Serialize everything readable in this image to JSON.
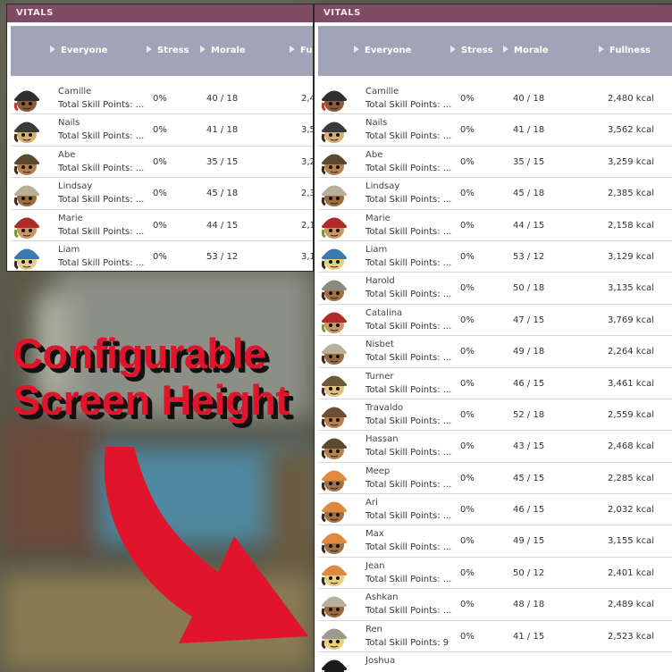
{
  "window_title": "VITALS",
  "headers": {
    "everyone": "Everyone",
    "stress": "Stress",
    "morale": "Morale",
    "fullness": "Fullness",
    "fullness_cut": "Fu"
  },
  "promo": {
    "line1": "Configurable",
    "line2": "Screen Height"
  },
  "left_rows": [
    {
      "name": "Camille",
      "skill": "Total Skill Points: ...",
      "stress": "0%",
      "morale": "40 / 18",
      "fullness": "2,4",
      "helmet": "#2f2f2f",
      "skin": "#8a5a3a",
      "hair": "#c03a2a"
    },
    {
      "name": "Nails",
      "skill": "Total Skill Points: ...",
      "stress": "0%",
      "morale": "41 / 18",
      "fullness": "3,5",
      "helmet": "#3a3a3a",
      "skin": "#d4b070",
      "hair": "#3a2a1a"
    },
    {
      "name": "Abe",
      "skill": "Total Skill Points: ...",
      "stress": "0%",
      "morale": "35 / 15",
      "fullness": "3,2",
      "helmet": "#5a4a30",
      "skin": "#b58050",
      "hair": "#3a2a1a"
    },
    {
      "name": "Lindsay",
      "skill": "Total Skill Points: ...",
      "stress": "0%",
      "morale": "45 / 18",
      "fullness": "2,3",
      "helmet": "#b8b09a",
      "skin": "#9a6a40",
      "hair": "#3a2a1a"
    },
    {
      "name": "Marie",
      "skill": "Total Skill Points: ...",
      "stress": "0%",
      "morale": "44 / 15",
      "fullness": "2,1",
      "helmet": "#b02a2a",
      "skin": "#c89868",
      "hair": "#7a9a30"
    },
    {
      "name": "Liam",
      "skill": "Total Skill Points: ...",
      "stress": "0%",
      "morale": "53 / 12",
      "fullness": "3,1",
      "helmet": "#3a7ab0",
      "skin": "#e8d080",
      "hair": "#3a2a1a"
    }
  ],
  "right_rows": [
    {
      "name": "Camille",
      "skill": "Total Skill Points: ...",
      "stress": "0%",
      "morale": "40 / 18",
      "fullness": "2,480 kcal",
      "helmet": "#2f2f2f",
      "skin": "#8a5a3a",
      "hair": "#c03a2a"
    },
    {
      "name": "Nails",
      "skill": "Total Skill Points: ...",
      "stress": "0%",
      "morale": "41 / 18",
      "fullness": "3,562 kcal",
      "helmet": "#3a3a3a",
      "skin": "#d4b070",
      "hair": "#3a2a1a"
    },
    {
      "name": "Abe",
      "skill": "Total Skill Points: ...",
      "stress": "0%",
      "morale": "35 / 15",
      "fullness": "3,259 kcal",
      "helmet": "#5a4a30",
      "skin": "#b58050",
      "hair": "#3a2a1a"
    },
    {
      "name": "Lindsay",
      "skill": "Total Skill Points: ...",
      "stress": "0%",
      "morale": "45 / 18",
      "fullness": "2,385 kcal",
      "helmet": "#b8b09a",
      "skin": "#9a6a40",
      "hair": "#3a2a1a"
    },
    {
      "name": "Marie",
      "skill": "Total Skill Points: ...",
      "stress": "0%",
      "morale": "44 / 15",
      "fullness": "2,158 kcal",
      "helmet": "#b02a2a",
      "skin": "#c89868",
      "hair": "#7a9a30"
    },
    {
      "name": "Liam",
      "skill": "Total Skill Points: ...",
      "stress": "0%",
      "morale": "53 / 12",
      "fullness": "3,129 kcal",
      "helmet": "#3a7ab0",
      "skin": "#e8d080",
      "hair": "#3a2a1a"
    },
    {
      "name": "Harold",
      "skill": "Total Skill Points: ...",
      "stress": "0%",
      "morale": "50 / 18",
      "fullness": "3,135 kcal",
      "helmet": "#8a8a80",
      "skin": "#a07048",
      "hair": "#3a2a1a"
    },
    {
      "name": "Catalina",
      "skill": "Total Skill Points: ...",
      "stress": "0%",
      "morale": "47 / 15",
      "fullness": "3,769 kcal",
      "helmet": "#b02a2a",
      "skin": "#c89868",
      "hair": "#7a9a30"
    },
    {
      "name": "Nisbet",
      "skill": "Total Skill Points: ...",
      "stress": "0%",
      "morale": "49 / 18",
      "fullness": "2,264 kcal",
      "helmet": "#b8b09a",
      "skin": "#9a6a40",
      "hair": "#3a2a1a"
    },
    {
      "name": "Turner",
      "skill": "Total Skill Points: ...",
      "stress": "0%",
      "morale": "46 / 15",
      "fullness": "3,461 kcal",
      "helmet": "#6a5a3a",
      "skin": "#e0c080",
      "hair": "#3a2a1a"
    },
    {
      "name": "Travaldo",
      "skill": "Total Skill Points: ...",
      "stress": "0%",
      "morale": "52 / 18",
      "fullness": "2,559 kcal",
      "helmet": "#6a5030",
      "skin": "#b58050",
      "hair": "#3a2a1a"
    },
    {
      "name": "Hassan",
      "skill": "Total Skill Points: ...",
      "stress": "0%",
      "morale": "43 / 15",
      "fullness": "2,468 kcal",
      "helmet": "#5a4a30",
      "skin": "#b58050",
      "hair": "#3a2a1a"
    },
    {
      "name": "Meep",
      "skill": "Total Skill Points: ...",
      "stress": "0%",
      "morale": "45 / 15",
      "fullness": "2,285 kcal",
      "helmet": "#e08a40",
      "skin": "#a07048",
      "hair": "#3a2a1a"
    },
    {
      "name": "Ari",
      "skill": "Total Skill Points: ...",
      "stress": "0%",
      "morale": "46 / 15",
      "fullness": "2,032 kcal",
      "helmet": "#e08a40",
      "skin": "#a07048",
      "hair": "#3a2a1a"
    },
    {
      "name": "Max",
      "skill": "Total Skill Points: ...",
      "stress": "0%",
      "morale": "49 / 15",
      "fullness": "3,155 kcal",
      "helmet": "#e08a40",
      "skin": "#a07048",
      "hair": "#3a2a1a"
    },
    {
      "name": "Jean",
      "skill": "Total Skill Points: ...",
      "stress": "0%",
      "morale": "50 / 12",
      "fullness": "2,401 kcal",
      "helmet": "#e08a40",
      "skin": "#e8d080",
      "hair": "#3a2a1a"
    },
    {
      "name": "Ashkan",
      "skill": "Total Skill Points: ...",
      "stress": "0%",
      "morale": "48 / 18",
      "fullness": "2,489 kcal",
      "helmet": "#b8b09a",
      "skin": "#9a6a40",
      "hair": "#3a2a1a"
    },
    {
      "name": "Ren",
      "skill": "Total Skill Points: 9",
      "stress": "0%",
      "morale": "41 / 15",
      "fullness": "2,523 kcal",
      "helmet": "#9a9a90",
      "skin": "#e8d080",
      "hair": "#3a2a1a"
    },
    {
      "name": "Joshua",
      "skill": "",
      "stress": "",
      "morale": "",
      "fullness": "",
      "helmet": "#1a1a1a",
      "skin": "#1a1a1a",
      "hair": "#1a1a1a"
    }
  ],
  "colors": {
    "title_bar": "#7e4b62",
    "header_row": "#a1a3b8",
    "promo_text": "#e0142a",
    "arrow": "#e0142a"
  }
}
